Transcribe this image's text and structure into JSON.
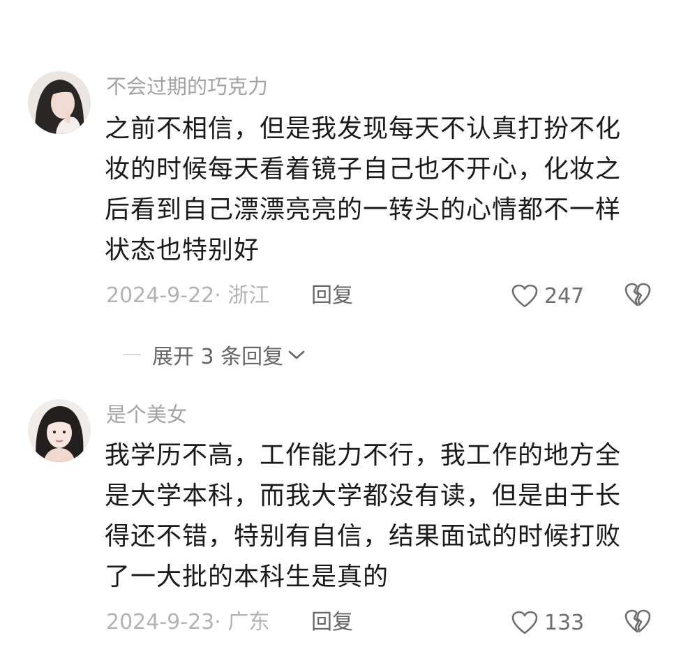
{
  "comments": [
    {
      "username": "不会过期的巧克力",
      "lines": [
        "之前不相信，但是我发现每天不认真打扮不化",
        "妆的时候每天看着镜子自己也不开心，化妆之",
        "后看到自己漂漂亮亮的一转头的心情都不一样",
        "状态也特别好"
      ],
      "meta": "2024-9-22· 浙江",
      "reply_label": "回复",
      "likes": "247"
    },
    {
      "username": "是个美女",
      "lines": [
        "我学历不高，工作能力不行，我工作的地方全",
        "是大学本科，而我大学都没有读，但是由于长",
        "得还不错，特别有自信，结果面试的时候打败",
        "了一大批的本科生是真的"
      ],
      "meta": "2024-9-23· 广东",
      "reply_label": "回复",
      "likes": "133"
    }
  ],
  "expand_replies": {
    "label": "展开 3 条回复"
  },
  "icons": {
    "like": "heart-outline-icon",
    "dislike": "broken-heart-icon",
    "expand": "chevron-down-icon"
  }
}
